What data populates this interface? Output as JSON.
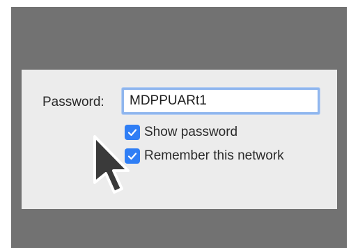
{
  "colors": {
    "backdrop": "#727272",
    "dialog": "#ececec",
    "accent": "#2f7ef5",
    "focus_ring": "#8fb6ee"
  },
  "form": {
    "password_label": "Password:",
    "password_value": "MDPPUARt1",
    "show_password_label": "Show password",
    "show_password_checked": true,
    "remember_network_label": "Remember this network",
    "remember_network_checked": true
  },
  "icons": {
    "checkbox_mark": "checkmark-icon",
    "pointer": "mouse-pointer-icon"
  }
}
